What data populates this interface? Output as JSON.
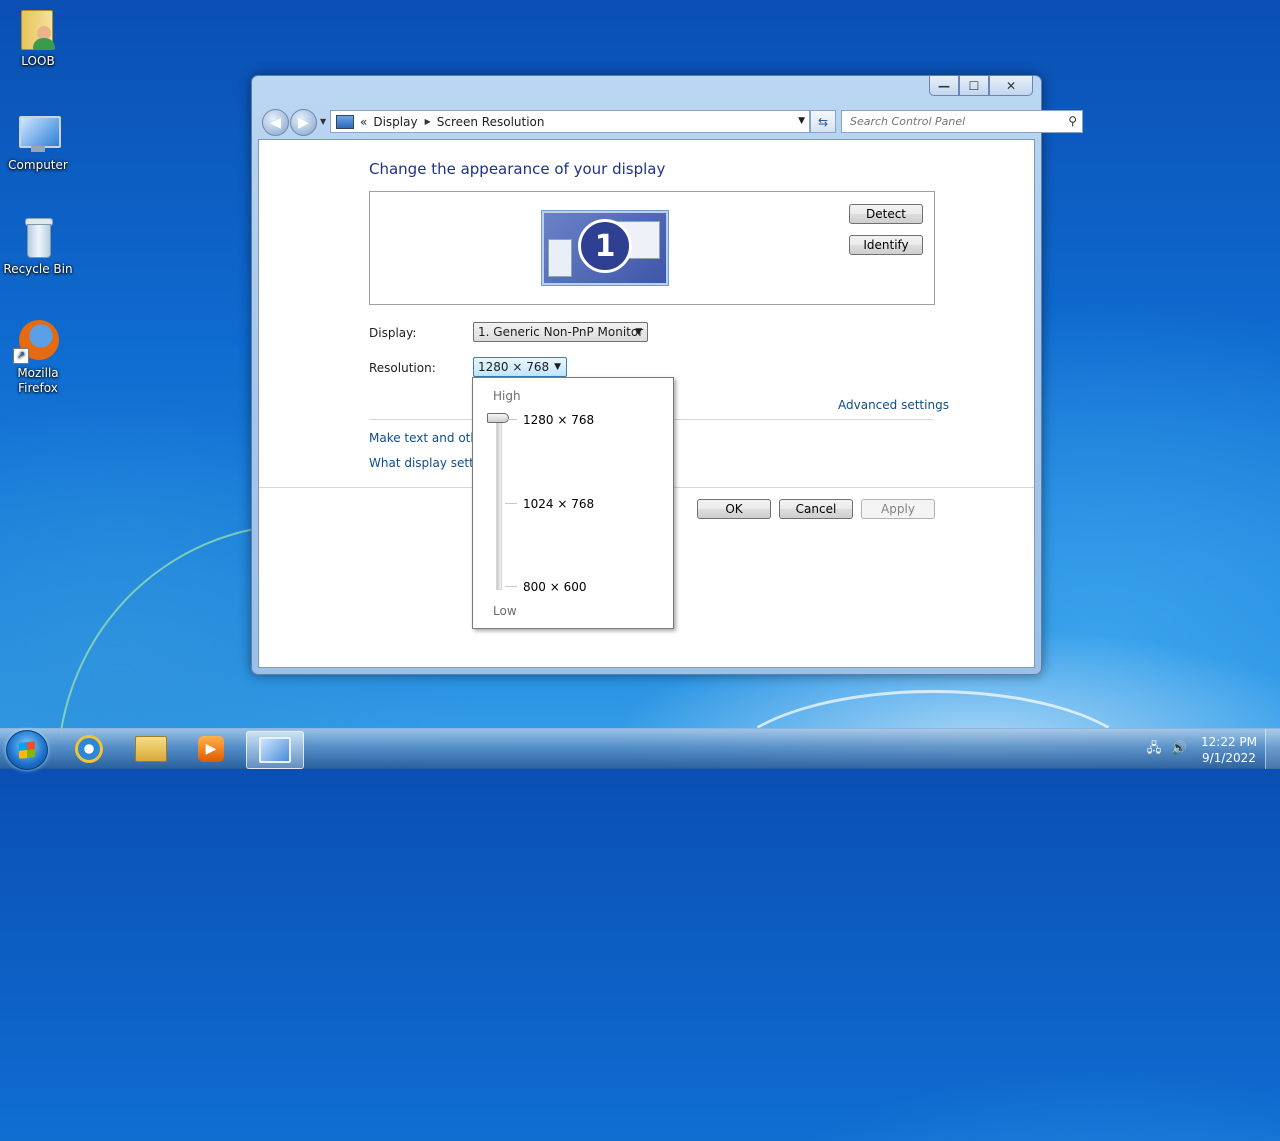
{
  "desktop": {
    "icons": [
      {
        "label": "LOOB"
      },
      {
        "label": "Computer"
      },
      {
        "label": "Recycle Bin"
      },
      {
        "label": "Mozilla Firefox"
      }
    ]
  },
  "window": {
    "controls": {
      "minimize": "—",
      "maximize": "☐",
      "close": "✕"
    },
    "address": {
      "prefix": "«",
      "segments": [
        "Display",
        "Screen Resolution"
      ]
    },
    "search": {
      "placeholder": "Search Control Panel"
    },
    "heading": "Change the appearance of your display",
    "monitor_number": "1",
    "buttons": {
      "detect": "Detect",
      "identify": "Identify",
      "ok": "OK",
      "cancel": "Cancel",
      "apply": "Apply"
    },
    "display": {
      "label": "Display:",
      "value": "1. Generic Non-PnP Monitor"
    },
    "resolution": {
      "label": "Resolution:",
      "value": "1280 × 768"
    },
    "links": {
      "advanced": "Advanced settings",
      "make_text": "Make text and other",
      "what_display": "What display setting"
    },
    "dropdown": {
      "high": "High",
      "low": "Low",
      "options": [
        "1280 × 768",
        "1024 × 768",
        "800 × 600"
      ],
      "selected_index": 0
    }
  },
  "taskbar": {
    "apps": [
      "internet-explorer",
      "windows-explorer",
      "media-player",
      "control-panel-display"
    ],
    "clock": {
      "time": "12:22 PM",
      "date": "9/1/2022"
    }
  },
  "colors": {
    "heading": "#1e3287",
    "link": "#0d4d8c"
  }
}
